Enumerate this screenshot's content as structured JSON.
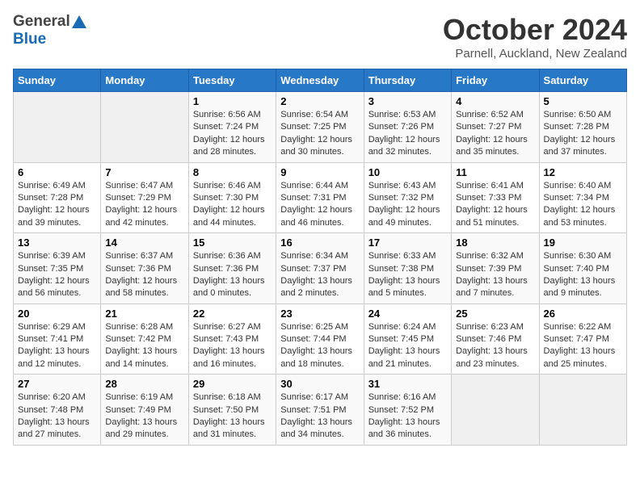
{
  "header": {
    "logo_general": "General",
    "logo_blue": "Blue",
    "title": "October 2024",
    "subtitle": "Parnell, Auckland, New Zealand"
  },
  "days_of_week": [
    "Sunday",
    "Monday",
    "Tuesday",
    "Wednesday",
    "Thursday",
    "Friday",
    "Saturday"
  ],
  "weeks": [
    [
      {
        "day": "",
        "sunrise": "",
        "sunset": "",
        "daylight": ""
      },
      {
        "day": "",
        "sunrise": "",
        "sunset": "",
        "daylight": ""
      },
      {
        "day": "1",
        "sunrise": "Sunrise: 6:56 AM",
        "sunset": "Sunset: 7:24 PM",
        "daylight": "Daylight: 12 hours and 28 minutes."
      },
      {
        "day": "2",
        "sunrise": "Sunrise: 6:54 AM",
        "sunset": "Sunset: 7:25 PM",
        "daylight": "Daylight: 12 hours and 30 minutes."
      },
      {
        "day": "3",
        "sunrise": "Sunrise: 6:53 AM",
        "sunset": "Sunset: 7:26 PM",
        "daylight": "Daylight: 12 hours and 32 minutes."
      },
      {
        "day": "4",
        "sunrise": "Sunrise: 6:52 AM",
        "sunset": "Sunset: 7:27 PM",
        "daylight": "Daylight: 12 hours and 35 minutes."
      },
      {
        "day": "5",
        "sunrise": "Sunrise: 6:50 AM",
        "sunset": "Sunset: 7:28 PM",
        "daylight": "Daylight: 12 hours and 37 minutes."
      }
    ],
    [
      {
        "day": "6",
        "sunrise": "Sunrise: 6:49 AM",
        "sunset": "Sunset: 7:28 PM",
        "daylight": "Daylight: 12 hours and 39 minutes."
      },
      {
        "day": "7",
        "sunrise": "Sunrise: 6:47 AM",
        "sunset": "Sunset: 7:29 PM",
        "daylight": "Daylight: 12 hours and 42 minutes."
      },
      {
        "day": "8",
        "sunrise": "Sunrise: 6:46 AM",
        "sunset": "Sunset: 7:30 PM",
        "daylight": "Daylight: 12 hours and 44 minutes."
      },
      {
        "day": "9",
        "sunrise": "Sunrise: 6:44 AM",
        "sunset": "Sunset: 7:31 PM",
        "daylight": "Daylight: 12 hours and 46 minutes."
      },
      {
        "day": "10",
        "sunrise": "Sunrise: 6:43 AM",
        "sunset": "Sunset: 7:32 PM",
        "daylight": "Daylight: 12 hours and 49 minutes."
      },
      {
        "day": "11",
        "sunrise": "Sunrise: 6:41 AM",
        "sunset": "Sunset: 7:33 PM",
        "daylight": "Daylight: 12 hours and 51 minutes."
      },
      {
        "day": "12",
        "sunrise": "Sunrise: 6:40 AM",
        "sunset": "Sunset: 7:34 PM",
        "daylight": "Daylight: 12 hours and 53 minutes."
      }
    ],
    [
      {
        "day": "13",
        "sunrise": "Sunrise: 6:39 AM",
        "sunset": "Sunset: 7:35 PM",
        "daylight": "Daylight: 12 hours and 56 minutes."
      },
      {
        "day": "14",
        "sunrise": "Sunrise: 6:37 AM",
        "sunset": "Sunset: 7:36 PM",
        "daylight": "Daylight: 12 hours and 58 minutes."
      },
      {
        "day": "15",
        "sunrise": "Sunrise: 6:36 AM",
        "sunset": "Sunset: 7:36 PM",
        "daylight": "Daylight: 13 hours and 0 minutes."
      },
      {
        "day": "16",
        "sunrise": "Sunrise: 6:34 AM",
        "sunset": "Sunset: 7:37 PM",
        "daylight": "Daylight: 13 hours and 2 minutes."
      },
      {
        "day": "17",
        "sunrise": "Sunrise: 6:33 AM",
        "sunset": "Sunset: 7:38 PM",
        "daylight": "Daylight: 13 hours and 5 minutes."
      },
      {
        "day": "18",
        "sunrise": "Sunrise: 6:32 AM",
        "sunset": "Sunset: 7:39 PM",
        "daylight": "Daylight: 13 hours and 7 minutes."
      },
      {
        "day": "19",
        "sunrise": "Sunrise: 6:30 AM",
        "sunset": "Sunset: 7:40 PM",
        "daylight": "Daylight: 13 hours and 9 minutes."
      }
    ],
    [
      {
        "day": "20",
        "sunrise": "Sunrise: 6:29 AM",
        "sunset": "Sunset: 7:41 PM",
        "daylight": "Daylight: 13 hours and 12 minutes."
      },
      {
        "day": "21",
        "sunrise": "Sunrise: 6:28 AM",
        "sunset": "Sunset: 7:42 PM",
        "daylight": "Daylight: 13 hours and 14 minutes."
      },
      {
        "day": "22",
        "sunrise": "Sunrise: 6:27 AM",
        "sunset": "Sunset: 7:43 PM",
        "daylight": "Daylight: 13 hours and 16 minutes."
      },
      {
        "day": "23",
        "sunrise": "Sunrise: 6:25 AM",
        "sunset": "Sunset: 7:44 PM",
        "daylight": "Daylight: 13 hours and 18 minutes."
      },
      {
        "day": "24",
        "sunrise": "Sunrise: 6:24 AM",
        "sunset": "Sunset: 7:45 PM",
        "daylight": "Daylight: 13 hours and 21 minutes."
      },
      {
        "day": "25",
        "sunrise": "Sunrise: 6:23 AM",
        "sunset": "Sunset: 7:46 PM",
        "daylight": "Daylight: 13 hours and 23 minutes."
      },
      {
        "day": "26",
        "sunrise": "Sunrise: 6:22 AM",
        "sunset": "Sunset: 7:47 PM",
        "daylight": "Daylight: 13 hours and 25 minutes."
      }
    ],
    [
      {
        "day": "27",
        "sunrise": "Sunrise: 6:20 AM",
        "sunset": "Sunset: 7:48 PM",
        "daylight": "Daylight: 13 hours and 27 minutes."
      },
      {
        "day": "28",
        "sunrise": "Sunrise: 6:19 AM",
        "sunset": "Sunset: 7:49 PM",
        "daylight": "Daylight: 13 hours and 29 minutes."
      },
      {
        "day": "29",
        "sunrise": "Sunrise: 6:18 AM",
        "sunset": "Sunset: 7:50 PM",
        "daylight": "Daylight: 13 hours and 31 minutes."
      },
      {
        "day": "30",
        "sunrise": "Sunrise: 6:17 AM",
        "sunset": "Sunset: 7:51 PM",
        "daylight": "Daylight: 13 hours and 34 minutes."
      },
      {
        "day": "31",
        "sunrise": "Sunrise: 6:16 AM",
        "sunset": "Sunset: 7:52 PM",
        "daylight": "Daylight: 13 hours and 36 minutes."
      },
      {
        "day": "",
        "sunrise": "",
        "sunset": "",
        "daylight": ""
      },
      {
        "day": "",
        "sunrise": "",
        "sunset": "",
        "daylight": ""
      }
    ]
  ]
}
